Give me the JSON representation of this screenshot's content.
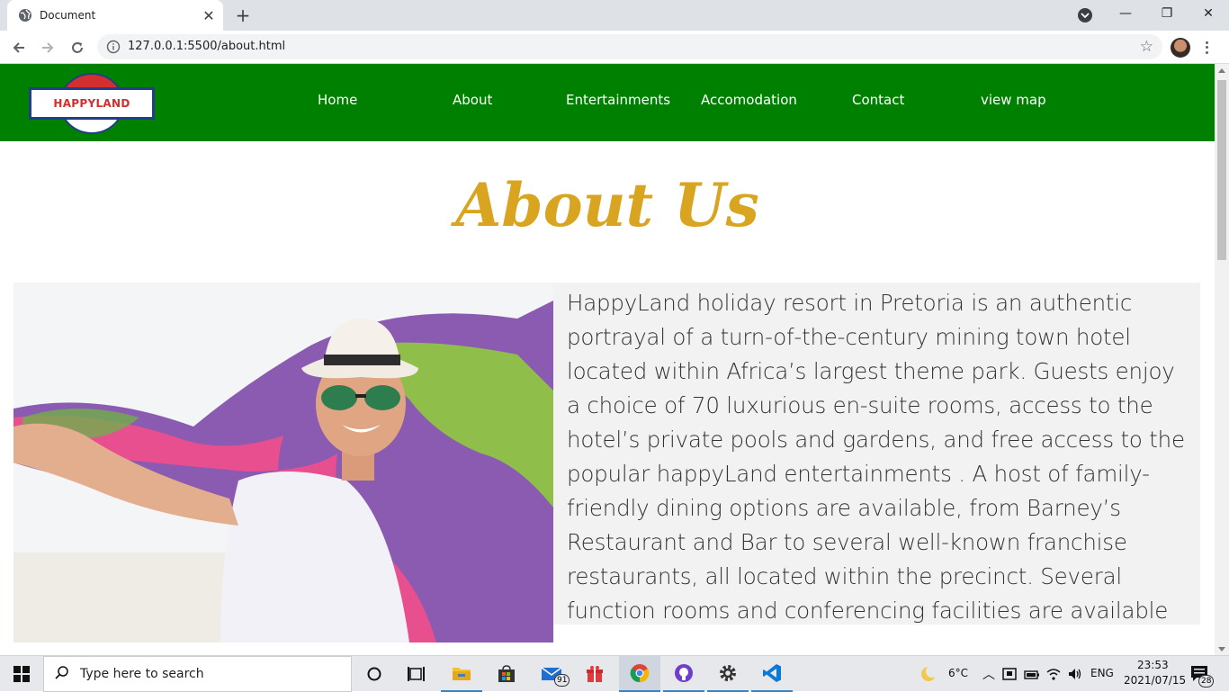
{
  "browser": {
    "tab_title": "Document",
    "tab_close": "✕",
    "new_tab": "+",
    "url": "127.0.0.1:5500/about.html",
    "window_controls": {
      "minimize": "—",
      "restore": "❐",
      "close": "✕"
    }
  },
  "site": {
    "logo_text": "HAPPYLAND",
    "nav": [
      "Home",
      "About",
      "Entertainments",
      "Accomodation",
      "Contact",
      "view map"
    ],
    "title": "About Us",
    "body": "HappyLand holiday resort in Pretoria is an authentic portrayal of a turn-of-the-century mining town hotel located within Africa’s largest theme park. Guests enjoy a choice of 70 luxurious en-suite rooms, access to the hotel’s private pools and gardens, and free access to the popular happyLand entertainments . A host of family-friendly dining options are available, from Barney’s Restaurant and Bar to several well-known franchise restaurants, all located within the precinct. Several function rooms and conferencing facilities are available"
  },
  "taskbar": {
    "search_placeholder": "Type here to search",
    "mail_badge": "91",
    "weather": "6°C",
    "language": "ENG",
    "time": "23:53",
    "date": "2021/07/15",
    "notification_count": "28"
  },
  "colors": {
    "nav_green": "#008000",
    "title_gold": "#d9a520",
    "logo_red": "#d32f2f",
    "logo_blue": "#1f3f8a"
  },
  "icons": [
    "globe-icon",
    "back-arrow-icon",
    "forward-arrow-icon",
    "reload-icon",
    "info-icon",
    "star-icon",
    "windows-logo-icon",
    "search-icon",
    "cortana-icon",
    "task-view-icon",
    "file-explorer-icon",
    "store-icon",
    "mail-icon",
    "gift-icon",
    "chrome-icon",
    "github-icon",
    "settings-icon",
    "vscode-icon",
    "weather-moon-icon",
    "notification-icon"
  ]
}
